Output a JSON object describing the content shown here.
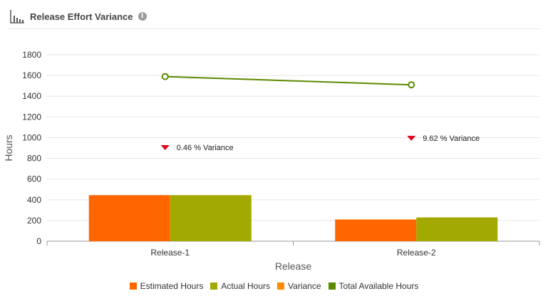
{
  "header": {
    "title": "Release Effort Variance",
    "icon": "bar-chart-icon",
    "info_icon": "info-icon",
    "info_glyph": "i"
  },
  "chart_data": {
    "type": "bar",
    "categories": [
      "Release-1",
      "Release-2"
    ],
    "xlabel": "Release",
    "ylabel": "Hours",
    "ylim": [
      0,
      1800
    ],
    "yticks": [
      0,
      200,
      400,
      600,
      800,
      1000,
      1200,
      1400,
      1600,
      1800
    ],
    "grid": true,
    "legend_position": "bottom",
    "series": [
      {
        "name": "Estimated Hours",
        "type": "bar",
        "color": "#ff6600",
        "values": [
          445,
          210
        ]
      },
      {
        "name": "Actual Hours",
        "type": "bar",
        "color": "#a2a900",
        "values": [
          445,
          230
        ]
      },
      {
        "name": "Variance",
        "type": "marker",
        "color": "#ff8c00",
        "marker_color": "#e3001b",
        "values": [
          900,
          990
        ],
        "labels": [
          "0.46 % Variance",
          "9.62 % Variance"
        ]
      },
      {
        "name": "Total Available Hours",
        "type": "line",
        "color": "#5c8a00",
        "values": [
          1590,
          1510
        ]
      }
    ]
  }
}
